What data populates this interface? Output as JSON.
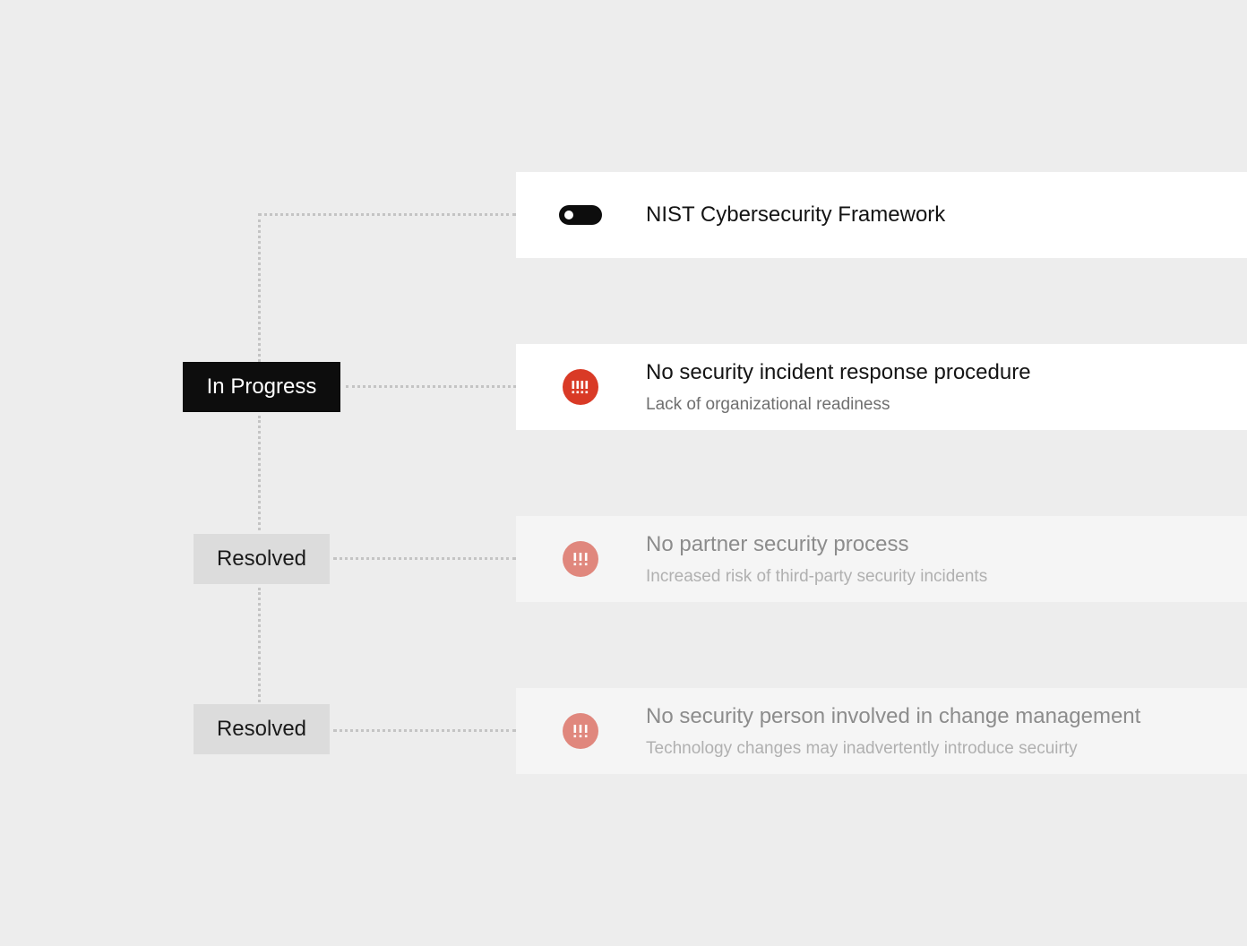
{
  "framework": {
    "title": "NIST Cybersecurity Framework",
    "toggle_icon": "toggle-icon"
  },
  "issues": [
    {
      "status": "In Progress",
      "title": "No security incident response procedure",
      "subtitle": "Lack of organizational readiness",
      "icon": "alert-icon",
      "icon_color": "#d93a26"
    },
    {
      "status": "Resolved",
      "title": "No partner security process",
      "subtitle": "Increased risk of third-party security incidents",
      "icon": "alert-icon",
      "icon_color": "#e0877d"
    },
    {
      "status": "Resolved",
      "title": "No security person involved in change management",
      "subtitle": "Technology changes may inadvertently introduce secuirty",
      "icon": "alert-icon",
      "icon_color": "#e0877d"
    }
  ],
  "colors": {
    "background": "#ededed",
    "in_progress_badge": "#0d0d0d",
    "resolved_badge": "#dcdcdc",
    "connector": "#c4c4c4"
  }
}
